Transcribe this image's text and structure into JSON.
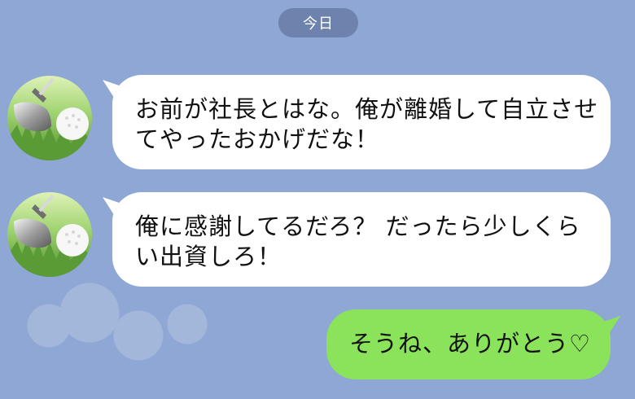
{
  "chat": {
    "date_label": "今日",
    "messages": [
      {
        "side": "incoming",
        "avatar_icon": "golf-avatar-icon",
        "lines": [
          "お前が社長とはな。俺が離婚して自立させ",
          "てやったおかげだな！"
        ]
      },
      {
        "side": "incoming",
        "avatar_icon": "golf-avatar-icon",
        "lines": [
          "俺に感謝してるだろ？ だったら少しくら",
          "い出資しろ！"
        ]
      },
      {
        "side": "outgoing",
        "lines": [
          "そうね、ありがとう♡"
        ]
      }
    ]
  },
  "colors": {
    "background": "#8fa7d4",
    "incoming_bubble": "#ffffff",
    "outgoing_bubble": "#8ae35b",
    "date_pill": "#56698f"
  }
}
